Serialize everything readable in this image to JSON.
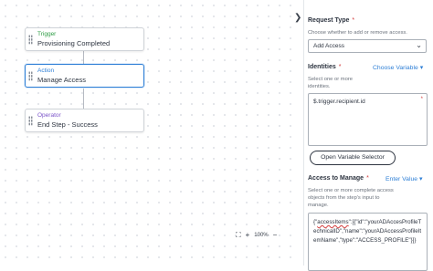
{
  "canvas": {
    "nodes": [
      {
        "kind": "Trigger",
        "title": "Provisioning Completed"
      },
      {
        "kind": "Action",
        "title": "Manage Access"
      },
      {
        "kind": "Operator",
        "title": "End Step - Success"
      }
    ],
    "zoom": "100%",
    "icons": {
      "fit": "fit-view-icon",
      "zoom_in": "plus-icon",
      "zoom_out": "minus-icon"
    }
  },
  "panel": {
    "collapse_icon": "chevron-right-icon",
    "request_type": {
      "label": "Request Type",
      "required": "*",
      "help": "Choose whether to add or remove access.",
      "value": "Add Access"
    },
    "identities": {
      "label": "Identities",
      "required": "*",
      "variable_link": "Choose Variable",
      "help": "Select one or more identities.",
      "value": "$.trigger.recipient.id",
      "field_required": "*",
      "open_selector_button": "Open Variable Selector"
    },
    "access_to_manage": {
      "label": "Access to Manage",
      "required": "*",
      "value_link": "Enter Value",
      "help": "Select one or more complete access objects from the step's input to manage.",
      "code_prefix": "{\"",
      "code_key": "accessItems",
      "code_rest": "\":[{\"id\":\"yourADAccesProfileTechnicalID\",\"name\":\"yourADAccessProfileItemName\",\"type\":\"ACCESS_PROFILE\"}]}"
    }
  },
  "colors": {
    "accent": "#2e7fd6",
    "trigger": "#2e9c45",
    "operator": "#7b53c9",
    "required": "#d23b3b"
  }
}
